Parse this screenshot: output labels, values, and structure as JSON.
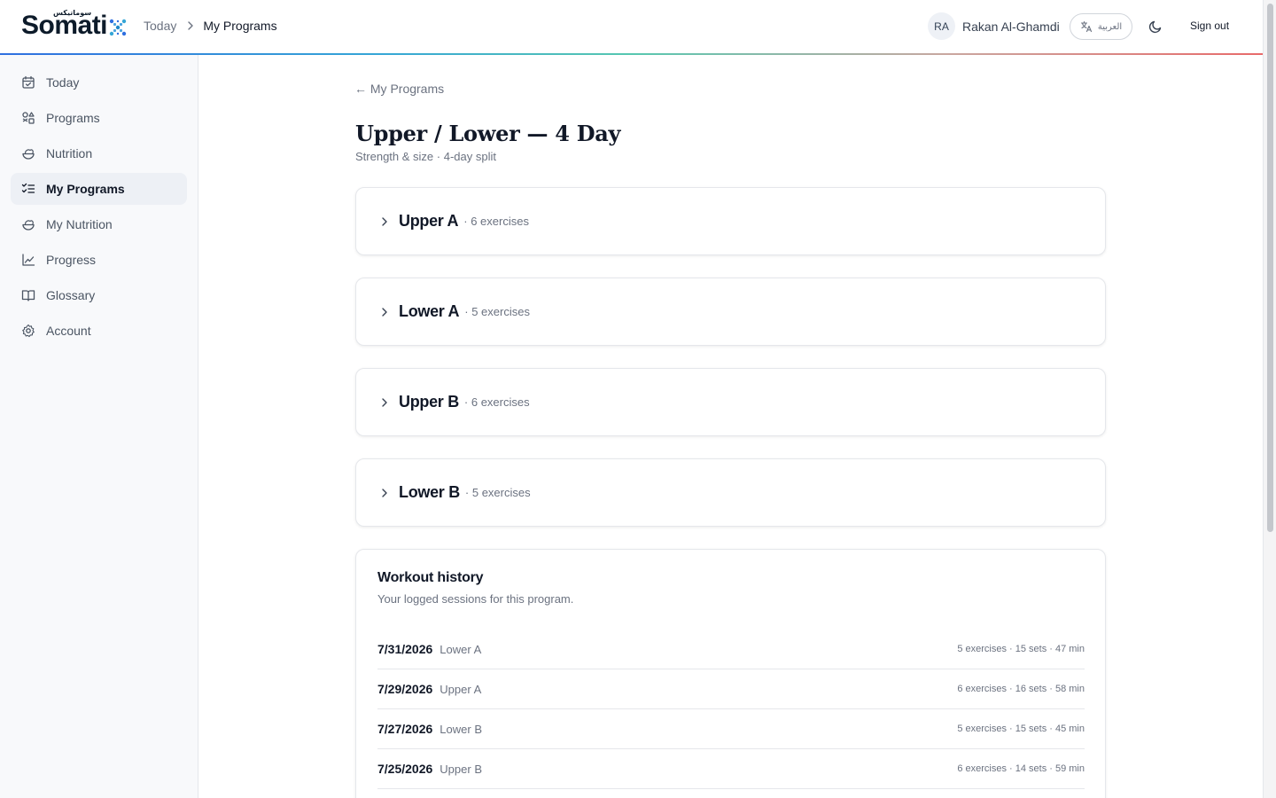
{
  "header": {
    "logo": "Somati",
    "logo_arabic": "سوماتيكس",
    "breadcrumb": {
      "home": "Today",
      "current": "My Programs"
    },
    "user": {
      "initials": "RA",
      "name": "Rakan Al-Ghamdi"
    },
    "language_label": "العربية",
    "sign_out": "Sign out"
  },
  "sidebar": {
    "items": [
      {
        "label": "Today",
        "icon": "calendar-icon",
        "active": false
      },
      {
        "label": "Programs",
        "icon": "shapes-icon",
        "active": false
      },
      {
        "label": "Nutrition",
        "icon": "salad-icon",
        "active": false
      },
      {
        "label": "My Programs",
        "icon": "list-checks-icon",
        "active": true
      },
      {
        "label": "My Nutrition",
        "icon": "salad-icon",
        "active": false
      },
      {
        "label": "Progress",
        "icon": "line-chart-icon",
        "active": false
      },
      {
        "label": "Glossary",
        "icon": "book-icon",
        "active": false
      },
      {
        "label": "Account",
        "icon": "gear-icon",
        "active": false
      }
    ]
  },
  "main": {
    "back_label": "← My Programs",
    "title": "Upper / Lower — 4 Day",
    "subtitle": "Strength & size · 4-day split",
    "days": [
      {
        "name": "Upper A",
        "count": "· 6 exercises"
      },
      {
        "name": "Lower A",
        "count": "· 5 exercises"
      },
      {
        "name": "Upper B",
        "count": "· 6 exercises"
      },
      {
        "name": "Lower B",
        "count": "· 5 exercises"
      }
    ],
    "history": {
      "title": "Workout history",
      "subtitle": "Your logged sessions for this program.",
      "rows": [
        {
          "date": "7/31/2026",
          "day": "Lower A",
          "meta": "5 exercises · 15 sets · 47 min"
        },
        {
          "date": "7/29/2026",
          "day": "Upper A",
          "meta": "6 exercises · 16 sets · 58 min"
        },
        {
          "date": "7/27/2026",
          "day": "Lower B",
          "meta": "5 exercises · 15 sets · 45 min"
        },
        {
          "date": "7/25/2026",
          "day": "Upper B",
          "meta": "6 exercises · 14 sets · 59 min"
        }
      ]
    }
  },
  "colors": {
    "accent_gradient_start": "#2f6fe0",
    "accent_gradient_mid": "#57c7b0",
    "accent_gradient_end": "#e86a6a",
    "active_nav_bg": "#edf0f5"
  }
}
